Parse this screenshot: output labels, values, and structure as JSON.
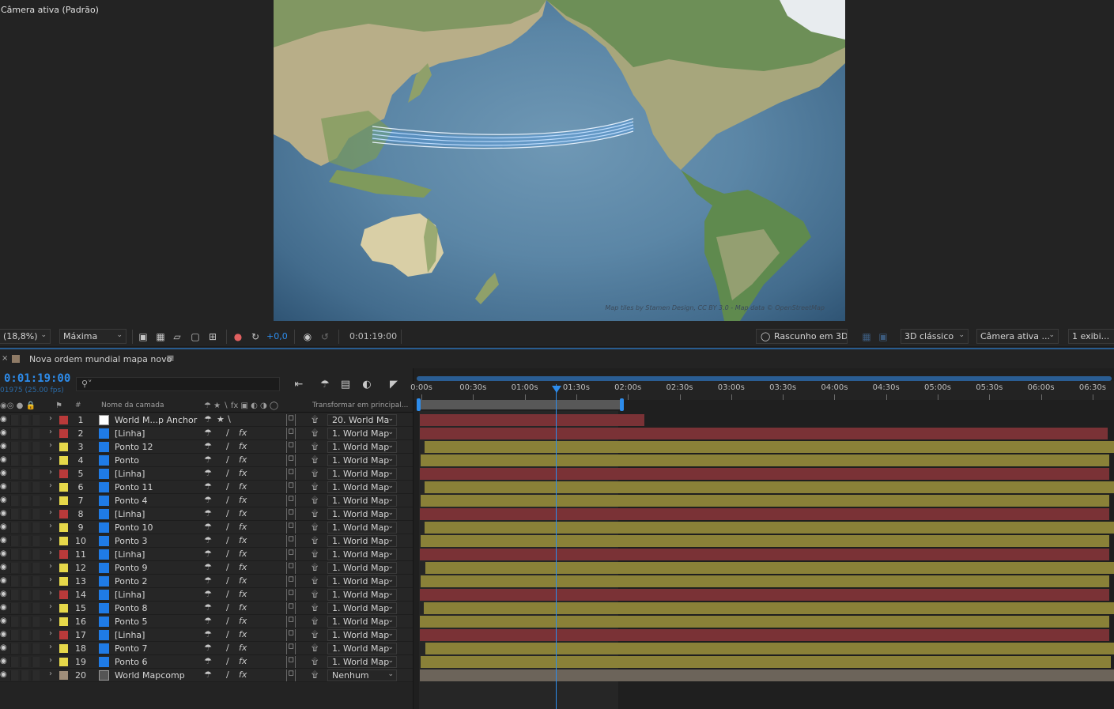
{
  "viewer": {
    "title": "Câmera ativa (Padrão)",
    "map_credit": "Map tiles by Stamen Design, CC BY 3.0 - Map data © OpenStreetMap"
  },
  "viewer_toolbar": {
    "zoom": "(18,8%)",
    "resolution": "Máxima",
    "exposure": "+0,0",
    "time": "0:01:19:00",
    "draft3d": "Rascunho em 3D",
    "renderer": "3D clássico",
    "camera": "Câmera ativa ...",
    "views": "1 exibi..."
  },
  "timeline": {
    "comp_name": "Nova ordem mundial mapa novo",
    "timecode": "0:01:19:00",
    "frames": "01975 (25.00 fps)",
    "search_placeholder": "",
    "headers": {
      "hash": "#",
      "layer_name": "Nome da camada",
      "parent": "Transformar em principal..."
    },
    "ruler": [
      "0:00s",
      "00:30s",
      "01:00s",
      "01:30s",
      "02:00s",
      "02:30s",
      "03:00s",
      "03:30s",
      "04:00s",
      "04:30s",
      "05:00s",
      "05:30s",
      "06:00s",
      "06:30s"
    ],
    "layers": [
      {
        "num": "1",
        "name": "World M...p Anchor",
        "label": "red",
        "type": "white",
        "parent": "20. World Ma"
      },
      {
        "num": "2",
        "name": "[Linha]",
        "label": "red",
        "type": "blue",
        "parent": "1. World Map"
      },
      {
        "num": "3",
        "name": "Ponto 12",
        "label": "yellow",
        "type": "blue",
        "parent": "1. World Map"
      },
      {
        "num": "4",
        "name": "Ponto",
        "label": "yellow",
        "type": "blue",
        "parent": "1. World Map"
      },
      {
        "num": "5",
        "name": "[Linha]",
        "label": "red",
        "type": "blue",
        "parent": "1. World Map"
      },
      {
        "num": "6",
        "name": "Ponto 11",
        "label": "yellow",
        "type": "blue",
        "parent": "1. World Map"
      },
      {
        "num": "7",
        "name": "Ponto 4",
        "label": "yellow",
        "type": "blue",
        "parent": "1. World Map"
      },
      {
        "num": "8",
        "name": "[Linha]",
        "label": "red",
        "type": "blue",
        "parent": "1. World Map"
      },
      {
        "num": "9",
        "name": "Ponto 10",
        "label": "yellow",
        "type": "blue",
        "parent": "1. World Map"
      },
      {
        "num": "10",
        "name": "Ponto 3",
        "label": "yellow",
        "type": "blue",
        "parent": "1. World Map"
      },
      {
        "num": "11",
        "name": "[Linha]",
        "label": "red",
        "type": "blue",
        "parent": "1. World Map"
      },
      {
        "num": "12",
        "name": "Ponto 9",
        "label": "yellow",
        "type": "blue",
        "parent": "1. World Map"
      },
      {
        "num": "13",
        "name": "Ponto 2",
        "label": "yellow",
        "type": "blue",
        "parent": "1. World Map"
      },
      {
        "num": "14",
        "name": "[Linha]",
        "label": "red",
        "type": "blue",
        "parent": "1. World Map"
      },
      {
        "num": "15",
        "name": "Ponto 8",
        "label": "yellow",
        "type": "blue",
        "parent": "1. World Map"
      },
      {
        "num": "16",
        "name": "Ponto 5",
        "label": "yellow",
        "type": "blue",
        "parent": "1. World Map"
      },
      {
        "num": "17",
        "name": "[Linha]",
        "label": "red",
        "type": "blue",
        "parent": "1. World Map"
      },
      {
        "num": "18",
        "name": "Ponto 7",
        "label": "yellow",
        "type": "blue",
        "parent": "1. World Map"
      },
      {
        "num": "19",
        "name": "Ponto 6",
        "label": "yellow",
        "type": "blue",
        "parent": "1. World Map"
      },
      {
        "num": "20",
        "name": "World Mapcomp",
        "label": "tan",
        "type": "comp",
        "parent": "Nenhum"
      }
    ]
  },
  "colors": {
    "accent": "#2d8ceb",
    "label_red": "#b93a3a",
    "label_yellow": "#e6d84a",
    "label_tan": "#a08e7a",
    "bar_red": "#7a3236",
    "bar_yellow": "#8a8138",
    "bar_tan": "#6c645a",
    "type_blue": "#1f7be6"
  }
}
